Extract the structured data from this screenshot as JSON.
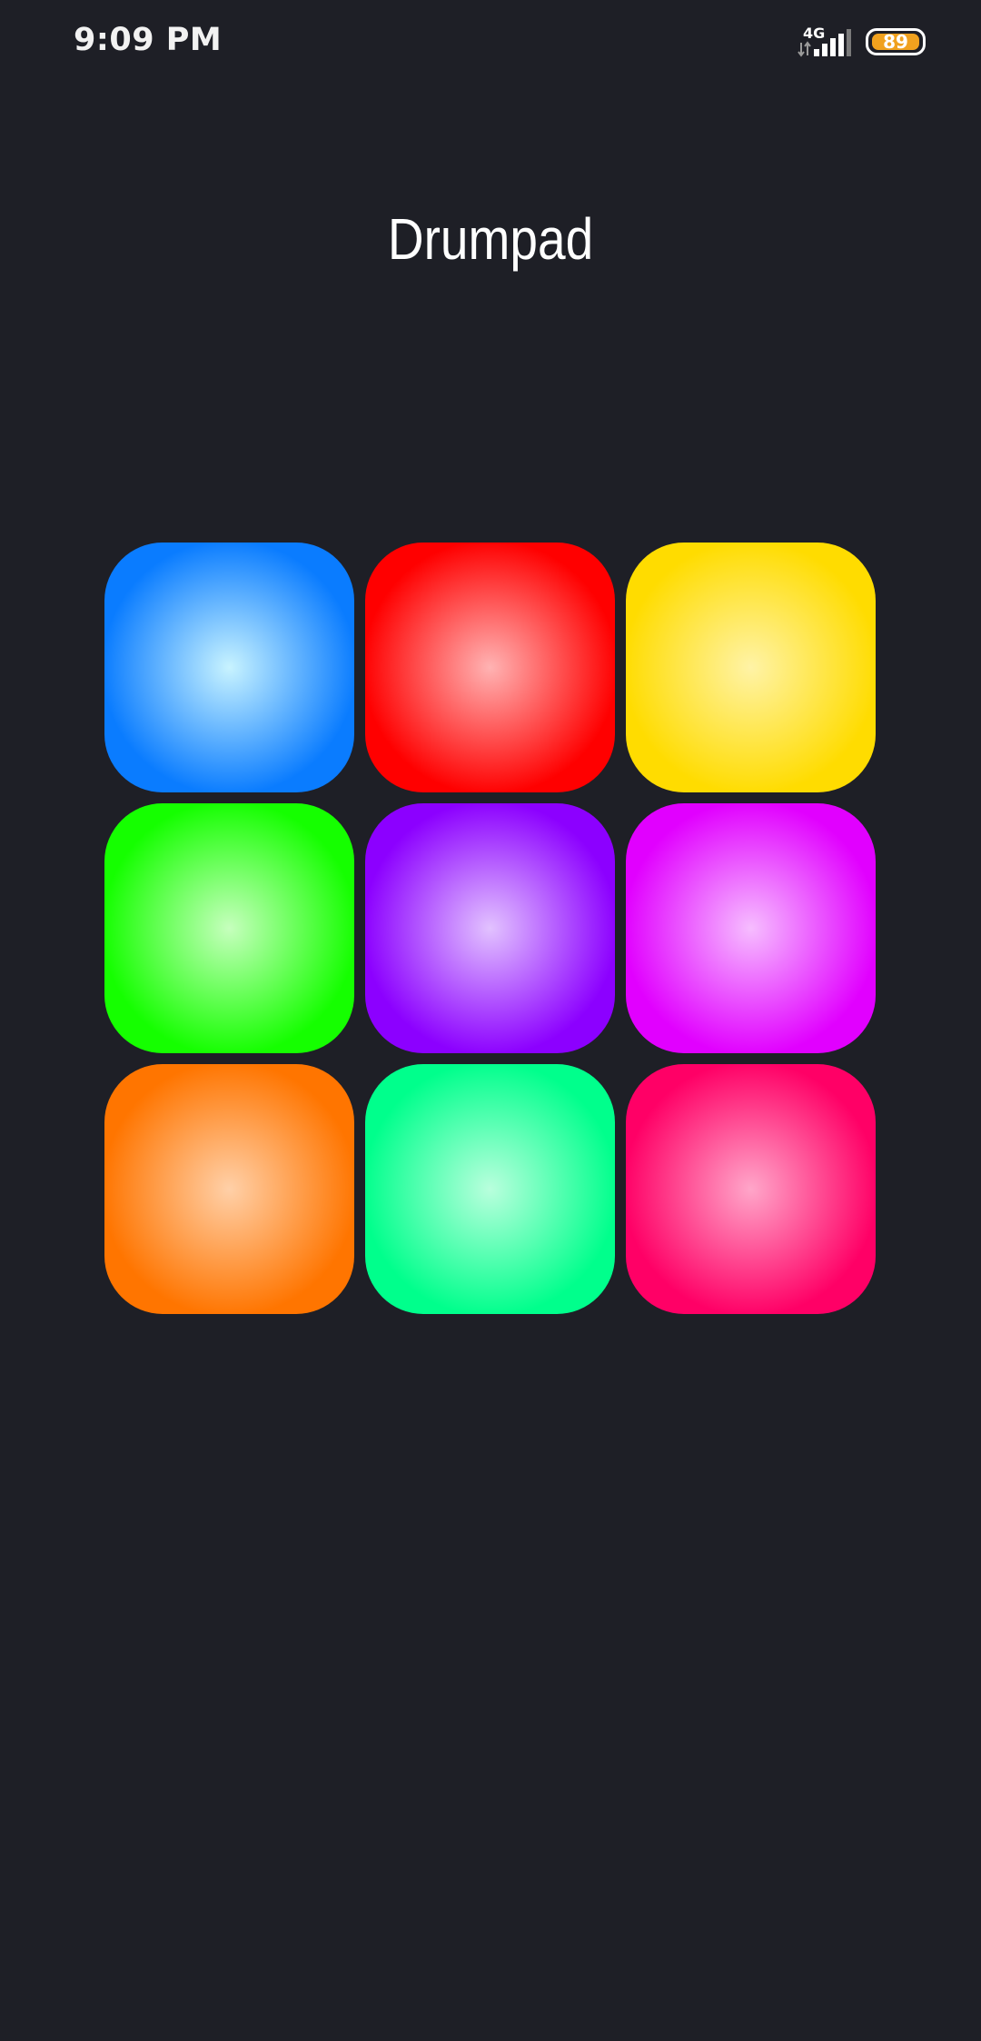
{
  "status_bar": {
    "time": "9:09 PM",
    "network": "4G",
    "battery": "89",
    "battery_color": "#f0a11e"
  },
  "app": {
    "title": "Drumpad"
  },
  "pads": [
    {
      "name": "blue",
      "color": "#0a7cff",
      "glow": "#c8f3ff"
    },
    {
      "name": "red",
      "color": "#ff0000",
      "glow": "#ffb3b3"
    },
    {
      "name": "yellow",
      "color": "#ffdc00",
      "glow": "#fff3a6"
    },
    {
      "name": "green",
      "color": "#15ff00",
      "glow": "#c6ffbd"
    },
    {
      "name": "purple",
      "color": "#8c00ff",
      "glow": "#e2c2ff"
    },
    {
      "name": "magenta",
      "color": "#e100ff",
      "glow": "#f6bdff"
    },
    {
      "name": "orange",
      "color": "#ff7500",
      "glow": "#ffd0a8"
    },
    {
      "name": "mint",
      "color": "#00ff8c",
      "glow": "#b9ffdd"
    },
    {
      "name": "pink",
      "color": "#ff0066",
      "glow": "#ffa6c9"
    }
  ]
}
